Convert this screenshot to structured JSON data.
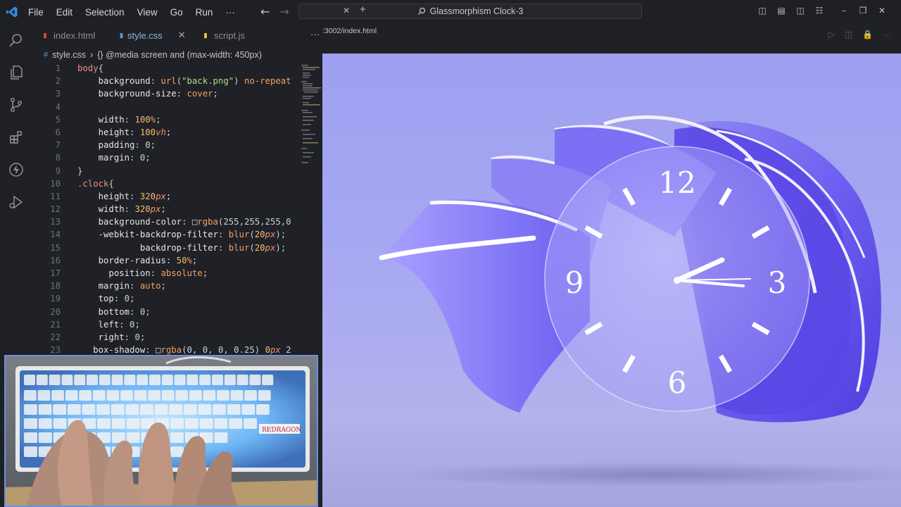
{
  "menu": [
    "File",
    "Edit",
    "Selection",
    "View",
    "Go",
    "Run",
    "···"
  ],
  "window": {
    "title": "Glassmorphism Clock-3"
  },
  "tabs": [
    {
      "name": "index.html",
      "badge": "5",
      "badge_color": "#e44d26"
    },
    {
      "name": "style.css",
      "badge": "#",
      "badge_color": "#5b9bd5"
    },
    {
      "name": "script.js",
      "badge": "JS",
      "badge_color": "#e6c84a"
    }
  ],
  "breadcrumb": {
    "file": "style.css",
    "path": "{} @media screen and (max-width: 450px)"
  },
  "code_lines": [
    {
      "n": "1",
      "t": "body{"
    },
    {
      "n": "2",
      "t": "    background: url(\"back.png\") no-repeat"
    },
    {
      "n": "3",
      "t": "    background-size: cover;"
    },
    {
      "n": "4",
      "t": ""
    },
    {
      "n": "5",
      "t": "    width: 100%;"
    },
    {
      "n": "6",
      "t": "    height: 100vh;"
    },
    {
      "n": "7",
      "t": "    padding: 0;"
    },
    {
      "n": "8",
      "t": "    margin: 0;"
    },
    {
      "n": "9",
      "t": "}"
    },
    {
      "n": "10",
      "t": ".clock{"
    },
    {
      "n": "11",
      "t": "    height: 320px;"
    },
    {
      "n": "12",
      "t": "    width: 320px;"
    },
    {
      "n": "13",
      "t": "    background-color: □rgba(255,255,255,0"
    },
    {
      "n": "14",
      "t": "    -webkit-backdrop-filter: blur(20px);"
    },
    {
      "n": "15",
      "t": "            backdrop-filter: blur(20px);"
    },
    {
      "n": "16",
      "t": "    border-radius: 50%;"
    },
    {
      "n": "17",
      "t": "      position: absolute;"
    },
    {
      "n": "18",
      "t": "    margin: auto;"
    },
    {
      "n": "19",
      "t": "    top: 0;"
    },
    {
      "n": "20",
      "t": "    bottom: 0;"
    },
    {
      "n": "21",
      "t": "    left: 0;"
    },
    {
      "n": "22",
      "t": "    right: 0;"
    },
    {
      "n": "23",
      "t": "   box-shadow: □rgba(0, 0, 0, 0.25) 0px 2"
    }
  ],
  "preview": {
    "url": ":3002/index.html"
  },
  "clock": {
    "n12": "12",
    "n3": "3",
    "n6": "6",
    "n9": "9"
  },
  "keyboard_brand": "REDRAGON"
}
